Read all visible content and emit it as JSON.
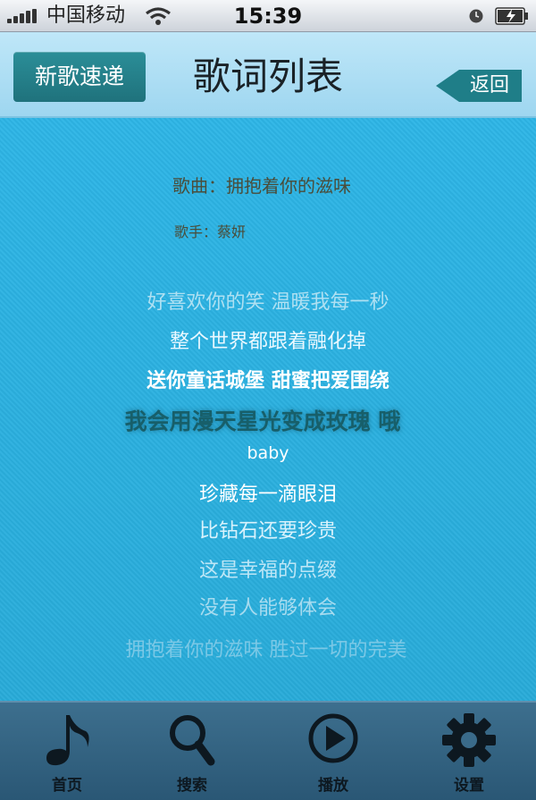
{
  "status_bar": {
    "carrier": "中国移动",
    "time": "15:39"
  },
  "nav": {
    "left_button": "新歌速递",
    "title": "歌词列表",
    "back_button": "返回"
  },
  "song": {
    "title_line": "歌曲：拥抱着你的滋味",
    "singer_line": "歌手：蔡妍"
  },
  "lyrics": [
    "好喜欢你的笑  温暖我每一秒",
    "整个世界都跟着融化掉",
    "送你童话城堡  甜蜜把爱围绕",
    "我会用漫天星光变成玫瑰  哦",
    "baby",
    "珍藏每一滴眼泪",
    "比钻石还要珍贵",
    "这是幸福的点缀",
    "没有人能够体会",
    "拥抱着你的滋味  胜过一切的完美"
  ],
  "tabs": [
    {
      "label": "首页",
      "icon": "music-note-icon"
    },
    {
      "label": "搜索",
      "icon": "search-icon"
    },
    {
      "label": "播放",
      "icon": "play-icon"
    },
    {
      "label": "设置",
      "icon": "gear-icon"
    }
  ],
  "colors": {
    "background": "#2cb0e0",
    "accent_button": "#1f7e88",
    "tabbar": "#3a6b8a"
  }
}
